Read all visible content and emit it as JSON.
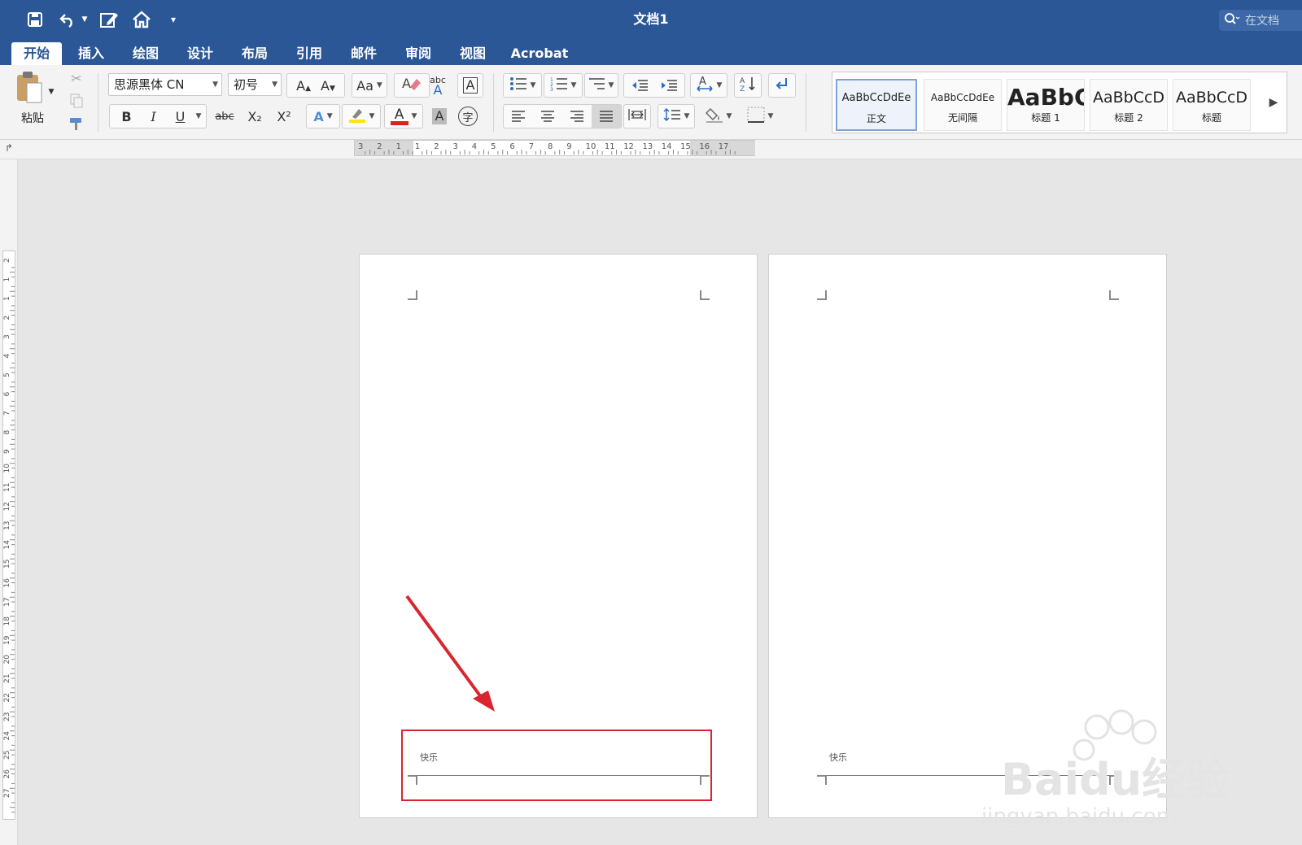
{
  "app": {
    "window_title": "文档1",
    "search_placeholder": "在文档"
  },
  "tabs": [
    {
      "label": "开始",
      "active": true
    },
    {
      "label": "插入"
    },
    {
      "label": "绘图"
    },
    {
      "label": "设计"
    },
    {
      "label": "布局"
    },
    {
      "label": "引用"
    },
    {
      "label": "邮件"
    },
    {
      "label": "审阅"
    },
    {
      "label": "视图"
    },
    {
      "label": "Acrobat"
    }
  ],
  "clipboard": {
    "paste_label": "粘贴"
  },
  "font": {
    "name": "思源黑体 CN",
    "size": "初号",
    "bold": "B",
    "italic": "I",
    "underline": "U",
    "strike": "abc",
    "subscript": "X₂",
    "superscript": "X²",
    "effects_glyph": "A",
    "highlight_color": "#ffe600",
    "font_color": "#e02020",
    "char_shading_glyph": "A",
    "phonetic_glyph": "字",
    "grow_glyph": "A",
    "shrink_glyph": "A",
    "change_case_glyph": "Aa",
    "spelling_glyph": "abc"
  },
  "styles": [
    {
      "sample": "AaBbCcDdEe",
      "name": "正文",
      "selected": true
    },
    {
      "sample": "AaBbCcDdEe",
      "name": "无间隔"
    },
    {
      "sample": "AaBbC",
      "name": "标题 1"
    },
    {
      "sample": "AaBbCcD",
      "name": "标题 2"
    },
    {
      "sample": "AaBbCcD",
      "name": "标题"
    }
  ],
  "ruler": {
    "h_labels": [
      "3",
      "2",
      "1",
      "1",
      "2",
      "3",
      "4",
      "5",
      "6",
      "7",
      "8",
      "9",
      "10",
      "11",
      "12",
      "13",
      "14",
      "15",
      "16",
      "17"
    ],
    "v_labels": [
      "2",
      "1",
      "1",
      "2",
      "3",
      "4",
      "5",
      "6",
      "7",
      "8",
      "9",
      "10",
      "11",
      "12",
      "13",
      "14",
      "15",
      "16",
      "17",
      "18",
      "19",
      "20",
      "21",
      "22",
      "23",
      "24",
      "25",
      "26",
      "27"
    ]
  },
  "pages": [
    {
      "footer_text": "快乐"
    },
    {
      "footer_text": "快乐"
    }
  ],
  "annotation": {
    "color": "#d9252f"
  },
  "watermark": {
    "line1": "Baidu经验",
    "line2": "jingyan.baidu.com"
  }
}
